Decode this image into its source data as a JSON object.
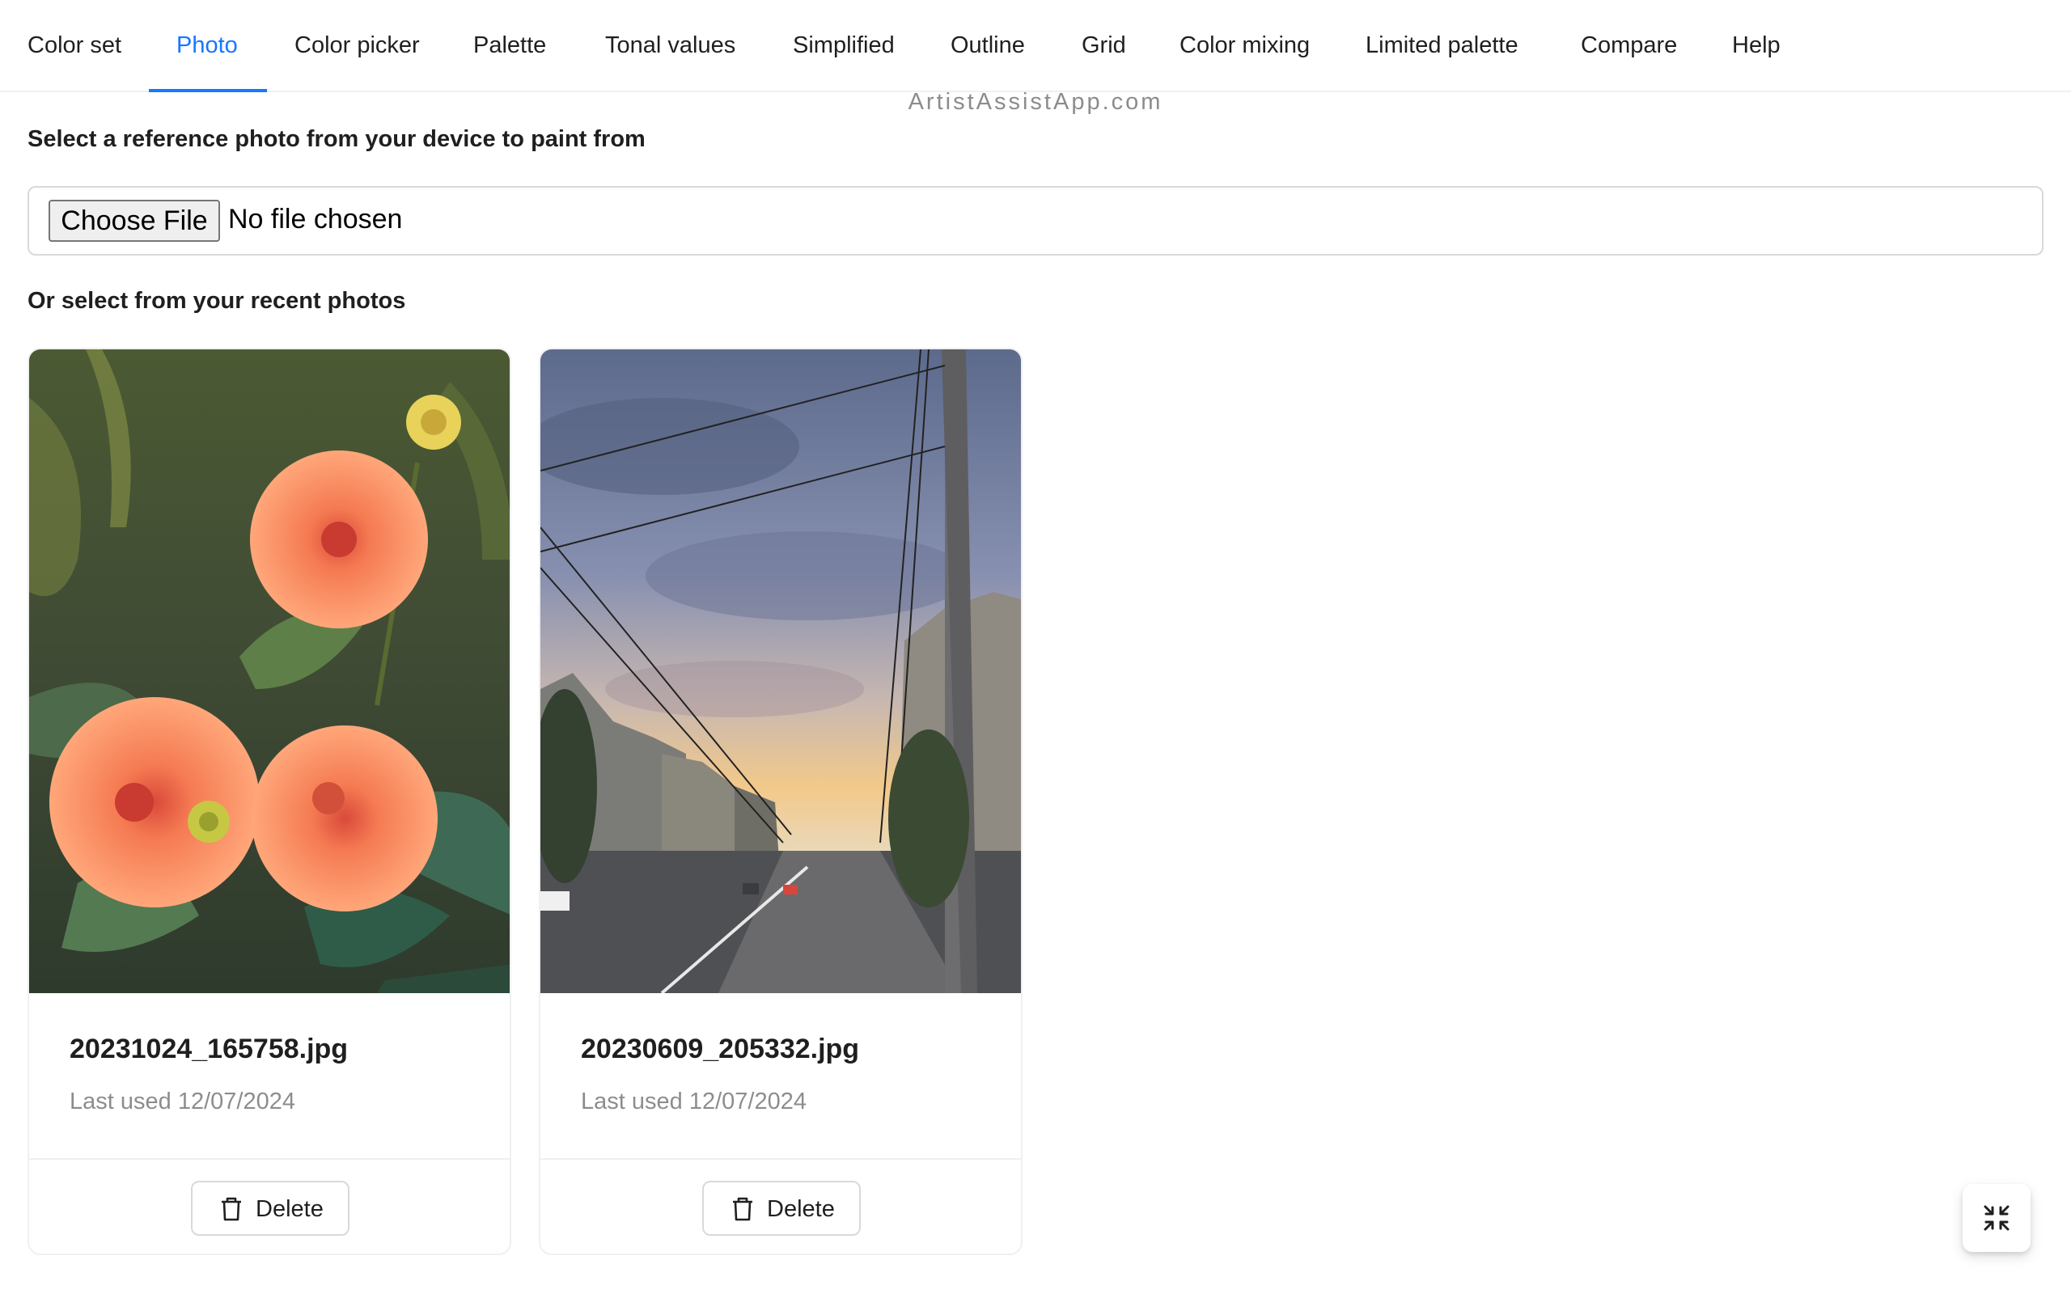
{
  "tabs": [
    {
      "label": "Color set",
      "active": false
    },
    {
      "label": "Photo",
      "active": true
    },
    {
      "label": "Color picker",
      "active": false
    },
    {
      "label": "Palette",
      "active": false
    },
    {
      "label": "Tonal values",
      "active": false
    },
    {
      "label": "Simplified",
      "active": false
    },
    {
      "label": "Outline",
      "active": false
    },
    {
      "label": "Grid",
      "active": false
    },
    {
      "label": "Color mixing",
      "active": false
    },
    {
      "label": "Limited palette",
      "active": false
    },
    {
      "label": "Compare",
      "active": false
    },
    {
      "label": "Help",
      "active": false
    }
  ],
  "watermark": "ArtistAssistApp.com",
  "upload": {
    "heading": "Select a reference photo from your device to paint from",
    "button_label": "Choose File",
    "status": "No file chosen"
  },
  "recent": {
    "heading": "Or select from your recent photos",
    "photos": [
      {
        "filename": "20231024_165758.jpg",
        "last_used": "Last used 12/07/2024",
        "delete_label": "Delete",
        "thumbnail": "orange-dahlia-flowers"
      },
      {
        "filename": "20230609_205332.jpg",
        "last_used": "Last used 12/07/2024",
        "delete_label": "Delete",
        "thumbnail": "city-street-sunset"
      }
    ]
  },
  "icons": {
    "delete": "trash-icon",
    "fullscreen_exit": "fullscreen-exit-icon"
  },
  "colors": {
    "accent": "#1677ff",
    "text": "#1f1f1f",
    "secondary_text": "#8c8c8c",
    "border": "#d9d9d9"
  }
}
